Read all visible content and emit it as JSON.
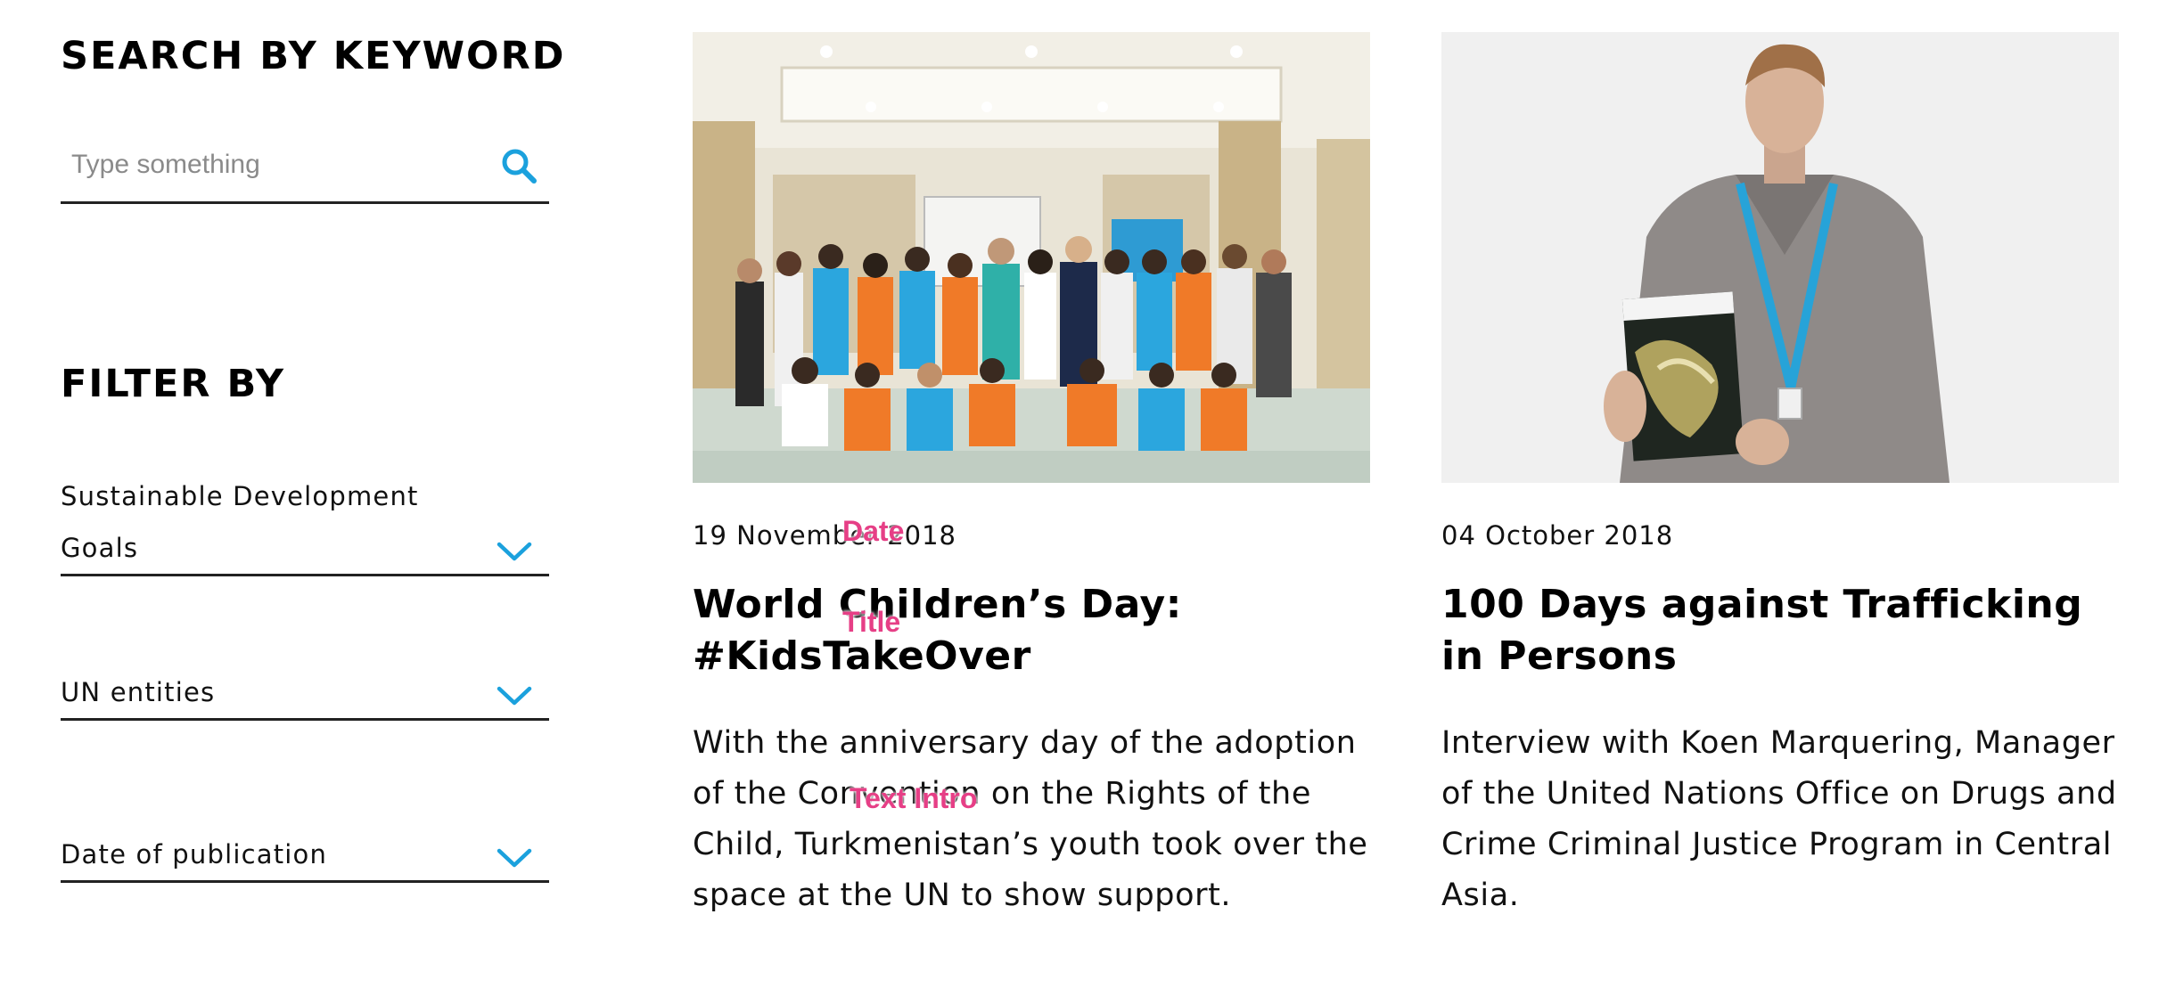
{
  "sidebar": {
    "search_title": "SEARCH BY KEYWORD",
    "search_placeholder": "Type something",
    "filter_title": "FILTER BY",
    "filters": [
      {
        "label": "Sustainable Development Goals"
      },
      {
        "label": "UN entities"
      },
      {
        "label": "Date of publication"
      }
    ]
  },
  "cards": [
    {
      "image_alt": "Group photo of youth in orange and blue UNICEF t-shirts in a conference hall",
      "date": "19 November 2018",
      "title": "World Children’s Day: #KidsTakeOver",
      "intro": "With the anniversary day of the adoption of the Convention on the Rights of the Child, Turkmenistan’s youth took over the space at the UN to show support."
    },
    {
      "image_alt": "Man holding a UNODC report on trafficking in persons",
      "date": "04 October 2018",
      "title": "100 Days against Trafficking in Persons",
      "intro": "Interview with Koen Marquering, Manager of the United Nations Office on Drugs and Crime Criminal Justice Program in Central Asia."
    }
  ],
  "annotations": {
    "date": "Date",
    "title": "Title",
    "text_intro": "Text Intro"
  },
  "colors": {
    "accent": "#1ba1dd",
    "annotation": "#e63f86",
    "divider": "#222222"
  }
}
